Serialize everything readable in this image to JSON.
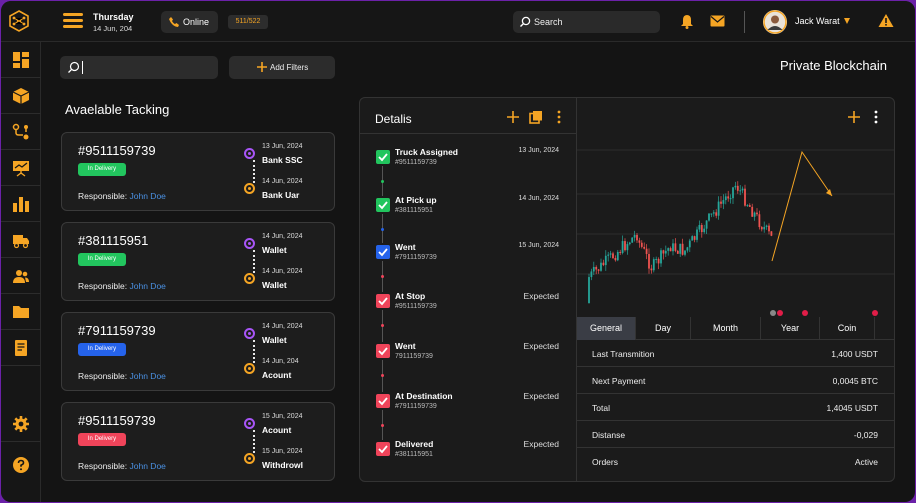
{
  "colors": {
    "accent": "#f5a524",
    "purple": "#a855f7",
    "green": "#22c55e",
    "blue": "#2563eb",
    "red": "#f0445a",
    "link": "#4a90e2"
  },
  "topbar": {
    "day": "Thursday",
    "date": "14 Jun, 204",
    "status_label": "Online",
    "count": "511/522",
    "search_label": "Search",
    "user_name": "Jack Warat"
  },
  "sidebar": {
    "icons": [
      "dashboard-icon",
      "box-icon",
      "route-icon",
      "presentation-icon",
      "bar-chart-icon",
      "truck-icon",
      "users-icon",
      "folder-icon",
      "document-icon"
    ],
    "bottom_icons": [
      "settings-icon",
      "help-icon"
    ]
  },
  "filters": {
    "add_label": "Add Filters"
  },
  "tracking": {
    "title": "Avaelable Tacking",
    "responsible_prefix": "Responsible:",
    "items": [
      {
        "id": "#9511159739",
        "status": "In Delivery",
        "status_color": "#22c55e",
        "responsible": "John Doe",
        "from_date": "13 Jun, 2024",
        "from_place": "Bank SSC",
        "to_date": "14 Jun, 2024",
        "to_place": "Bank Uar"
      },
      {
        "id": "#381115951",
        "status": "In Delivery",
        "status_color": "#22c55e",
        "responsible": "John Doe",
        "from_date": "14 Jun, 2024",
        "from_place": "Wallet",
        "to_date": "14 Jun, 2024",
        "to_place": "Wallet"
      },
      {
        "id": "#7911159739",
        "status": "In Delivery",
        "status_color": "#2563eb",
        "responsible": "John Doe",
        "from_date": "14 Jun, 2024",
        "from_place": "Wallet",
        "to_date": "14 Jun, 204",
        "to_place": "Acount"
      },
      {
        "id": "#9511159739",
        "status": "In Delivery",
        "status_color": "#f0445a",
        "responsible": "John Doe",
        "from_date": "15 Jun, 2024",
        "from_place": "Acount",
        "to_date": "15 Jun, 2024",
        "to_place": "Withdrowl"
      }
    ]
  },
  "page_title": "Private Blockchain",
  "details": {
    "title": "Detalis",
    "events": [
      {
        "title": "Truck Assigned",
        "sub": "#9511159739",
        "right": "13 Jun, 2024",
        "kind": "date",
        "color": "#22c55e"
      },
      {
        "title": "At Pick up",
        "sub": "#381115951",
        "right": "14 Jun, 2024",
        "kind": "date",
        "color": "#22c55e"
      },
      {
        "title": "Went",
        "sub": "#7911159739",
        "right": "15 Jun, 2024",
        "kind": "date",
        "color": "#2563eb"
      },
      {
        "title": "At Stop",
        "sub": "#9511159739",
        "right": "Expected",
        "kind": "expected",
        "color": "#f0445a"
      },
      {
        "title": "Went",
        "sub": "7911159739",
        "right": "Expected",
        "kind": "expected",
        "color": "#f0445a"
      },
      {
        "title": "At Destination",
        "sub": "#7911159739",
        "right": "Expected",
        "kind": "expected",
        "color": "#f0445a"
      },
      {
        "title": "Delivered",
        "sub": "#381115951",
        "right": "Expected",
        "kind": "expected",
        "color": "#f0445a"
      }
    ]
  },
  "tabs": [
    "General",
    "Day",
    "Month",
    "Year",
    "Coin"
  ],
  "active_tab": "General",
  "stats": [
    {
      "label": "Last Transmition",
      "value": "1,400 USDT"
    },
    {
      "label": "Next Payment",
      "value": "0,0045 BTC"
    },
    {
      "label": "Total",
      "value": "1,4045 USDT"
    },
    {
      "label": "Distanse",
      "value": "-0,029"
    },
    {
      "label": "Orders",
      "value": "Active"
    }
  ]
}
